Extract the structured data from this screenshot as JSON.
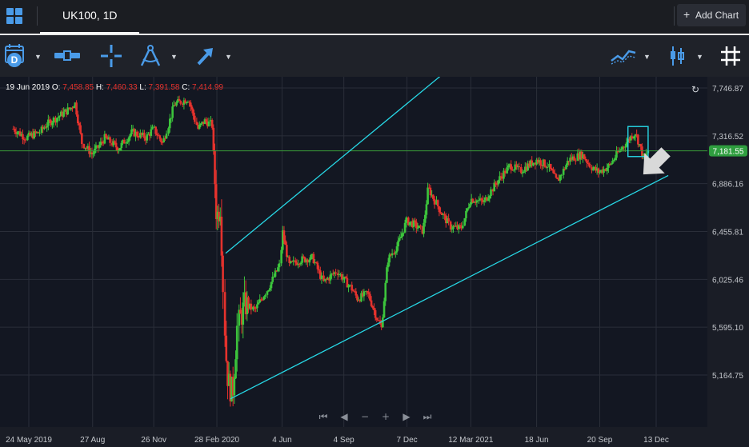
{
  "header": {
    "tab_label": "UK100, 1D",
    "add_chart_label": "Add Chart"
  },
  "toolbar": {
    "date_range_letter": "D"
  },
  "legend": {
    "date": "19 Jun 2019",
    "o_label": "O:",
    "o_value": "7,458.85",
    "h_label": "H:",
    "h_value": "7,460.33",
    "l_label": "L:",
    "l_value": "7,391.58",
    "c_label": "C:",
    "c_value": "7,414.99"
  },
  "colors": {
    "up": "#3cc43c",
    "down": "#e5322d",
    "channel": "#27d8e6",
    "price_line": "#3a9a3a",
    "price_badge": "#2f9e3f",
    "accent_icon": "#4a9be8"
  },
  "chart_data": {
    "type": "candlestick",
    "symbol": "UK100",
    "interval": "1D",
    "current_price": "7,181.55",
    "current_price_value": 7181.55,
    "y_axis": {
      "min": 4900,
      "max": 7850,
      "ticks": [
        {
          "value": 7746.87,
          "label": "7,746.87"
        },
        {
          "value": 7316.52,
          "label": "7,316.52"
        },
        {
          "value": 6886.16,
          "label": "6,886.16"
        },
        {
          "value": 6455.81,
          "label": "6,455.81"
        },
        {
          "value": 6025.46,
          "label": "6,025.46"
        },
        {
          "value": 5595.1,
          "label": "5,595.10"
        },
        {
          "value": 5164.75,
          "label": "5,164.75"
        }
      ]
    },
    "x_axis": {
      "ticks": [
        {
          "label": "24 May 2019",
          "date": "2019-05-24"
        },
        {
          "label": "27 Aug",
          "date": "2019-08-27"
        },
        {
          "label": "26 Nov",
          "date": "2019-11-26"
        },
        {
          "label": "28 Feb 2020",
          "date": "2020-02-28"
        },
        {
          "label": "4 Jun",
          "date": "2020-06-04"
        },
        {
          "label": "4 Sep",
          "date": "2020-09-04"
        },
        {
          "label": "7 Dec",
          "date": "2020-12-07"
        },
        {
          "label": "12 Mar 2021",
          "date": "2021-03-12"
        },
        {
          "label": "18 Jun",
          "date": "2021-06-18"
        },
        {
          "label": "20 Sep",
          "date": "2021-09-20"
        },
        {
          "label": "13 Dec",
          "date": "2021-12-13"
        }
      ]
    },
    "close_path": [
      [
        "2019-05-01",
        7380
      ],
      [
        "2019-05-20",
        7300
      ],
      [
        "2019-06-10",
        7350
      ],
      [
        "2019-06-19",
        7415
      ],
      [
        "2019-07-05",
        7480
      ],
      [
        "2019-07-25",
        7560
      ],
      [
        "2019-08-01",
        7620
      ],
      [
        "2019-08-12",
        7250
      ],
      [
        "2019-08-27",
        7150
      ],
      [
        "2019-09-15",
        7300
      ],
      [
        "2019-10-05",
        7200
      ],
      [
        "2019-10-25",
        7350
      ],
      [
        "2019-11-15",
        7300
      ],
      [
        "2019-11-26",
        7380
      ],
      [
        "2019-12-10",
        7250
      ],
      [
        "2019-12-27",
        7600
      ],
      [
        "2020-01-17",
        7650
      ],
      [
        "2020-01-31",
        7380
      ],
      [
        "2020-02-10",
        7450
      ],
      [
        "2020-02-21",
        7420
      ],
      [
        "2020-02-28",
        6580
      ],
      [
        "2020-03-05",
        6700
      ],
      [
        "2020-03-12",
        5400
      ],
      [
        "2020-03-16",
        5100
      ],
      [
        "2020-03-23",
        5000
      ],
      [
        "2020-03-30",
        5600
      ],
      [
        "2020-04-10",
        5800
      ],
      [
        "2020-04-25",
        5750
      ],
      [
        "2020-05-15",
        5950
      ],
      [
        "2020-06-01",
        6150
      ],
      [
        "2020-06-05",
        6450
      ],
      [
        "2020-06-15",
        6150
      ],
      [
        "2020-07-01",
        6200
      ],
      [
        "2020-07-20",
        6220
      ],
      [
        "2020-08-05",
        6000
      ],
      [
        "2020-08-25",
        6100
      ],
      [
        "2020-09-15",
        5950
      ],
      [
        "2020-09-25",
        5850
      ],
      [
        "2020-10-10",
        5900
      ],
      [
        "2020-10-30",
        5580
      ],
      [
        "2020-11-09",
        6200
      ],
      [
        "2020-11-25",
        6350
      ],
      [
        "2020-12-07",
        6550
      ],
      [
        "2020-12-18",
        6520
      ],
      [
        "2020-12-31",
        6460
      ],
      [
        "2021-01-08",
        6850
      ],
      [
        "2021-01-25",
        6650
      ],
      [
        "2021-02-10",
        6500
      ],
      [
        "2021-02-26",
        6480
      ],
      [
        "2021-03-12",
        6750
      ],
      [
        "2021-04-01",
        6720
      ],
      [
        "2021-04-20",
        6900
      ],
      [
        "2021-05-10",
        7050
      ],
      [
        "2021-05-25",
        7000
      ],
      [
        "2021-06-18",
        7100
      ],
      [
        "2021-07-05",
        7050
      ],
      [
        "2021-07-19",
        6900
      ],
      [
        "2021-08-05",
        7100
      ],
      [
        "2021-08-25",
        7150
      ],
      [
        "2021-09-10",
        7020
      ],
      [
        "2021-09-20",
        6990
      ],
      [
        "2021-10-05",
        7050
      ],
      [
        "2021-10-22",
        7200
      ],
      [
        "2021-11-05",
        7300
      ],
      [
        "2021-11-12",
        7350
      ],
      [
        "2021-11-26",
        7100
      ],
      [
        "2021-12-01",
        7181.55
      ]
    ],
    "annotations": [
      {
        "type": "trend_line",
        "name": "channel-upper",
        "from": [
          "2020-03-12",
          6260
        ],
        "to": [
          "2021-01-25",
          7850
        ]
      },
      {
        "type": "trend_line",
        "name": "channel-lower",
        "from": [
          "2020-03-19",
          4950
        ],
        "to": [
          "2021-12-31",
          6960
        ]
      },
      {
        "type": "rectangle",
        "name": "highlight-box",
        "from": [
          "2021-11-01",
          7130
        ],
        "to": [
          "2021-12-01",
          7400
        ]
      },
      {
        "type": "arrow",
        "name": "down-arrow",
        "direction": "down-right"
      },
      {
        "type": "horizontal_line",
        "name": "current-price-line",
        "value": 7181.55
      }
    ],
    "grid": true,
    "navigation": [
      "first",
      "prev",
      "zoom-out",
      "zoom-in",
      "next",
      "last"
    ]
  }
}
